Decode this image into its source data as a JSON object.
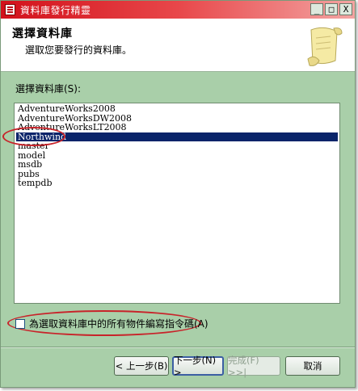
{
  "window": {
    "title": "資料庫發行精靈",
    "minimize": "_",
    "maximize": "□",
    "close": "X"
  },
  "header": {
    "title": "選擇資料庫",
    "subtitle": "選取您要發行的資料庫。"
  },
  "database_list": {
    "label": "選擇資料庫(S):",
    "items": [
      {
        "label": "AdventureWorks2008",
        "selected": false
      },
      {
        "label": "AdventureWorksDW2008",
        "selected": false
      },
      {
        "label": "AdventureWorksLT2008",
        "selected": false
      },
      {
        "label": "Northwind",
        "selected": true
      },
      {
        "label": "master",
        "selected": false
      },
      {
        "label": "model",
        "selected": false
      },
      {
        "label": "msdb",
        "selected": false
      },
      {
        "label": "pubs",
        "selected": false
      },
      {
        "label": "tempdb",
        "selected": false
      }
    ]
  },
  "script_all_objects": {
    "label": "為選取資料庫中的所有物件編寫指令碼(A)",
    "checked": false
  },
  "buttons": {
    "back": "< 上一步(B)",
    "next": "下一步(N) >",
    "finish": "完成(F) >>|",
    "cancel": "取消"
  },
  "colors": {
    "titlebar": "#d2111b",
    "window_bg": "#a9cfa9",
    "selection": "#0a246a",
    "annotation": "#c8232a"
  }
}
